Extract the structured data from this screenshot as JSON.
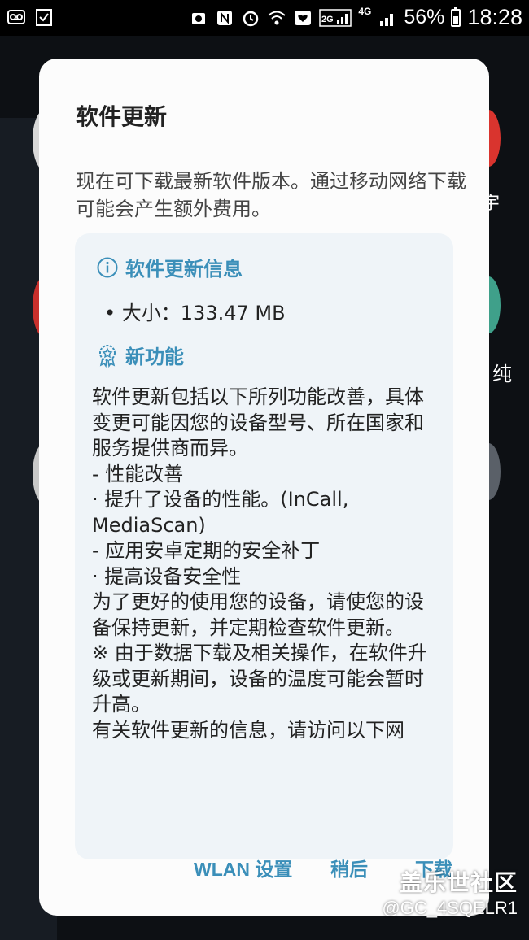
{
  "status_bar": {
    "battery": "56%",
    "time": "18:28",
    "network": "4G",
    "network_small": "2G"
  },
  "background": {
    "label_1": "纯",
    "label_2": "宇"
  },
  "dialog": {
    "title": "软件更新",
    "description": "现在可下载最新软件版本。通过移动网络下载可能会产生额外费用。",
    "info_header": "软件更新信息",
    "size_line": "• 大小：133.47 MB",
    "features_header": "新功能",
    "body_lines": [
      "软件更新包括以下所列功能改善，具体变更可能因您的设备型号、所在国家和服务提供商而异。",
      "",
      "- 性能改善",
      "· 提升了设备的性能。(InCall, MediaScan)",
      "- 应用安卓定期的安全补丁",
      "· 提高设备安全性",
      "",
      "为了更好的使用您的设备，请使您的设备保持更新，并定期检查软件更新。",
      "※ 由于数据下载及相关操作，在软件升级或更新期间，设备的温度可能会暂时升高。",
      "",
      "有关软件更新的信息，请访问以下网"
    ],
    "buttons": {
      "wlan": "WLAN 设置",
      "later": "稍后",
      "download": "下载"
    }
  },
  "watermark": {
    "brand": "盖乐世社区",
    "user": "@GC_4SQELR1"
  },
  "colors": {
    "accent": "#3b8fb9",
    "dialog_bg": "#fcfcfc",
    "info_box_bg": "#eff4f8"
  }
}
